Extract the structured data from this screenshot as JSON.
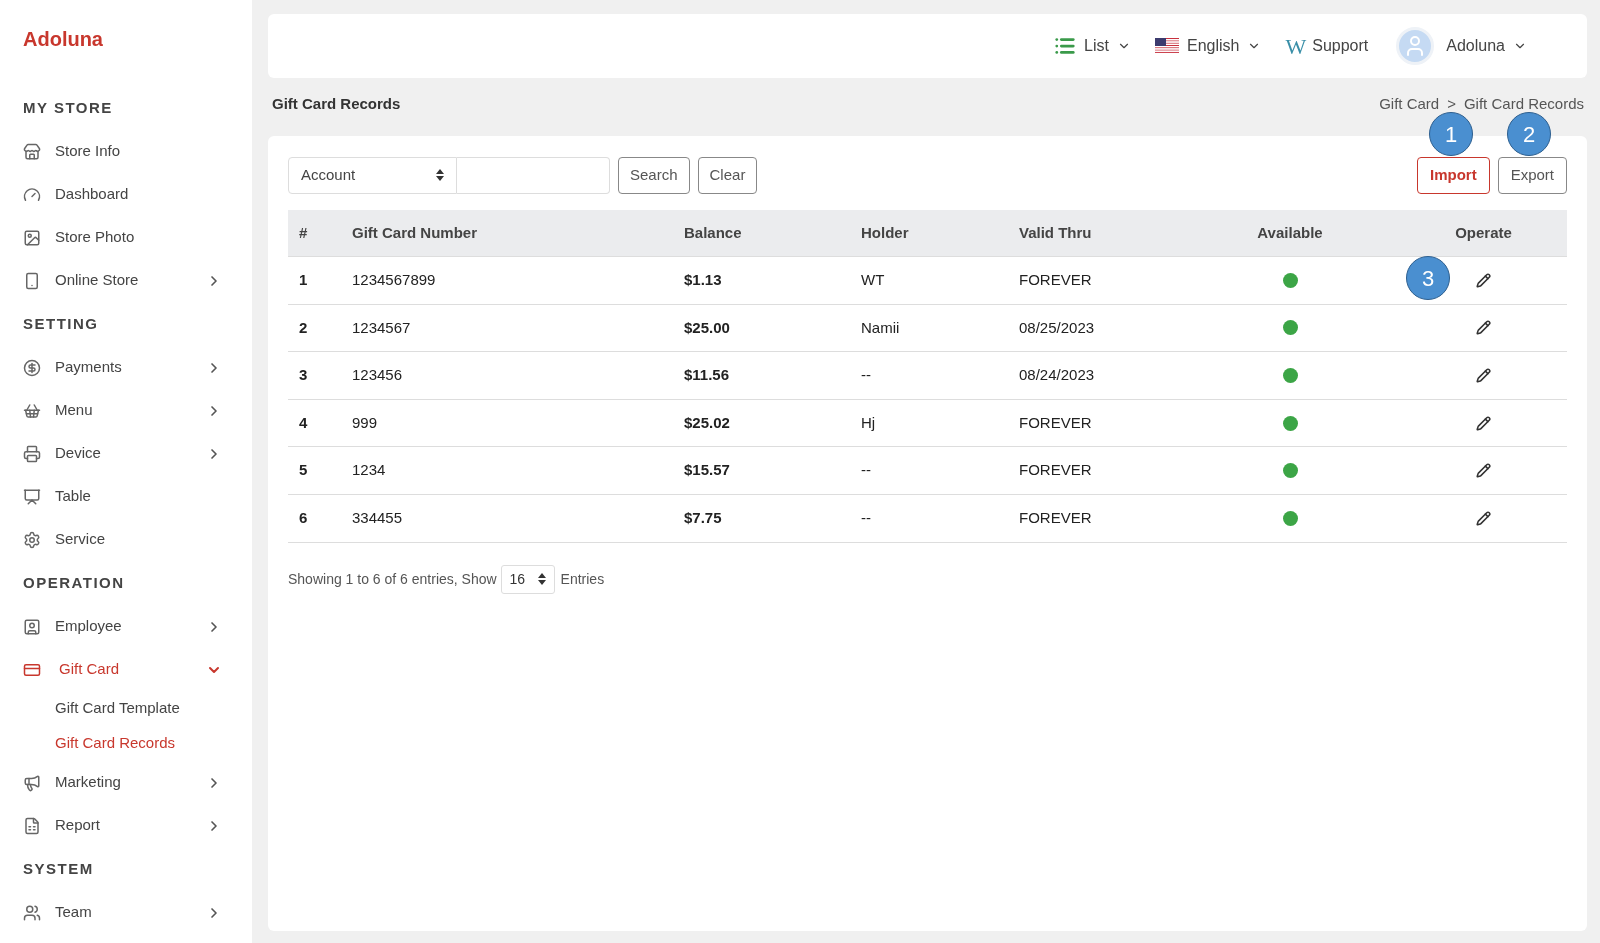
{
  "brand": "Adoluna",
  "sidebar": {
    "sections": [
      {
        "title": "MY STORE",
        "items": [
          {
            "label": "Store Info",
            "selected": false
          },
          {
            "label": "Dashboard",
            "selected": false
          },
          {
            "label": "Store Photo",
            "selected": false
          },
          {
            "label": "Online Store",
            "selected": false,
            "expanded": false
          }
        ]
      },
      {
        "title": "SETTING",
        "items": [
          {
            "label": "Payments",
            "selected": false,
            "expanded": false
          },
          {
            "label": "Menu",
            "selected": false,
            "expanded": false
          },
          {
            "label": "Device",
            "selected": false,
            "expanded": false
          },
          {
            "label": "Table",
            "selected": false
          },
          {
            "label": "Service",
            "selected": false
          }
        ]
      },
      {
        "title": "OPERATION",
        "items": [
          {
            "label": "Employee",
            "selected": false,
            "expanded": false
          },
          {
            "label": "Gift Card",
            "selected": true,
            "expanded": true,
            "children": [
              {
                "label": "Gift Card Template",
                "selected": false
              },
              {
                "label": "Gift Card Records",
                "selected": true
              }
            ]
          },
          {
            "label": "Marketing",
            "selected": false,
            "expanded": false
          },
          {
            "label": "Report",
            "selected": false,
            "expanded": false
          }
        ]
      },
      {
        "title": "SYSTEM",
        "items": [
          {
            "label": "Team",
            "selected": false,
            "expanded": false
          }
        ]
      }
    ]
  },
  "topbar": {
    "view": "List",
    "language": "English",
    "support_logo": "W",
    "support": "Support",
    "user": "Adoluna"
  },
  "page_title": "Gift Card Records",
  "breadcrumb": [
    "Gift Card",
    ">",
    "Gift Card Records"
  ],
  "filter": {
    "field": "Account",
    "buttons": [
      "Search",
      "Clear"
    ]
  },
  "actions": [
    {
      "label": "Import",
      "kind": "primary"
    },
    {
      "label": "Export",
      "kind": "default"
    }
  ],
  "table": {
    "columns": [
      "#",
      "Gift Card Number",
      "Balance",
      "Holder",
      "Valid Thru",
      "Available",
      "Operate"
    ],
    "rows": [
      {
        "index": "1",
        "number": "1234567899",
        "balance": "$1.13",
        "holder": "WT",
        "valid_thru": "FOREVER",
        "available": true
      },
      {
        "index": "2",
        "number": "1234567",
        "balance": "$25.00",
        "holder": "Namii",
        "valid_thru": "08/25/2023",
        "available": true
      },
      {
        "index": "3",
        "number": "123456",
        "balance": "$11.56",
        "holder": "--",
        "valid_thru": "08/24/2023",
        "available": true
      },
      {
        "index": "4",
        "number": "999",
        "balance": "$25.02",
        "holder": "Hj",
        "valid_thru": "FOREVER",
        "available": true
      },
      {
        "index": "5",
        "number": "1234",
        "balance": "$15.57",
        "holder": "--",
        "valid_thru": "FOREVER",
        "available": true
      },
      {
        "index": "6",
        "number": "334455",
        "balance": "$7.75",
        "holder": "--",
        "valid_thru": "FOREVER",
        "available": true
      }
    ]
  },
  "pagination": {
    "summary": "Showing 1 to 6 of 6 entries, Show",
    "page_size": "16",
    "suffix": "Entries"
  },
  "callouts": [
    "1",
    "2",
    "3"
  ]
}
